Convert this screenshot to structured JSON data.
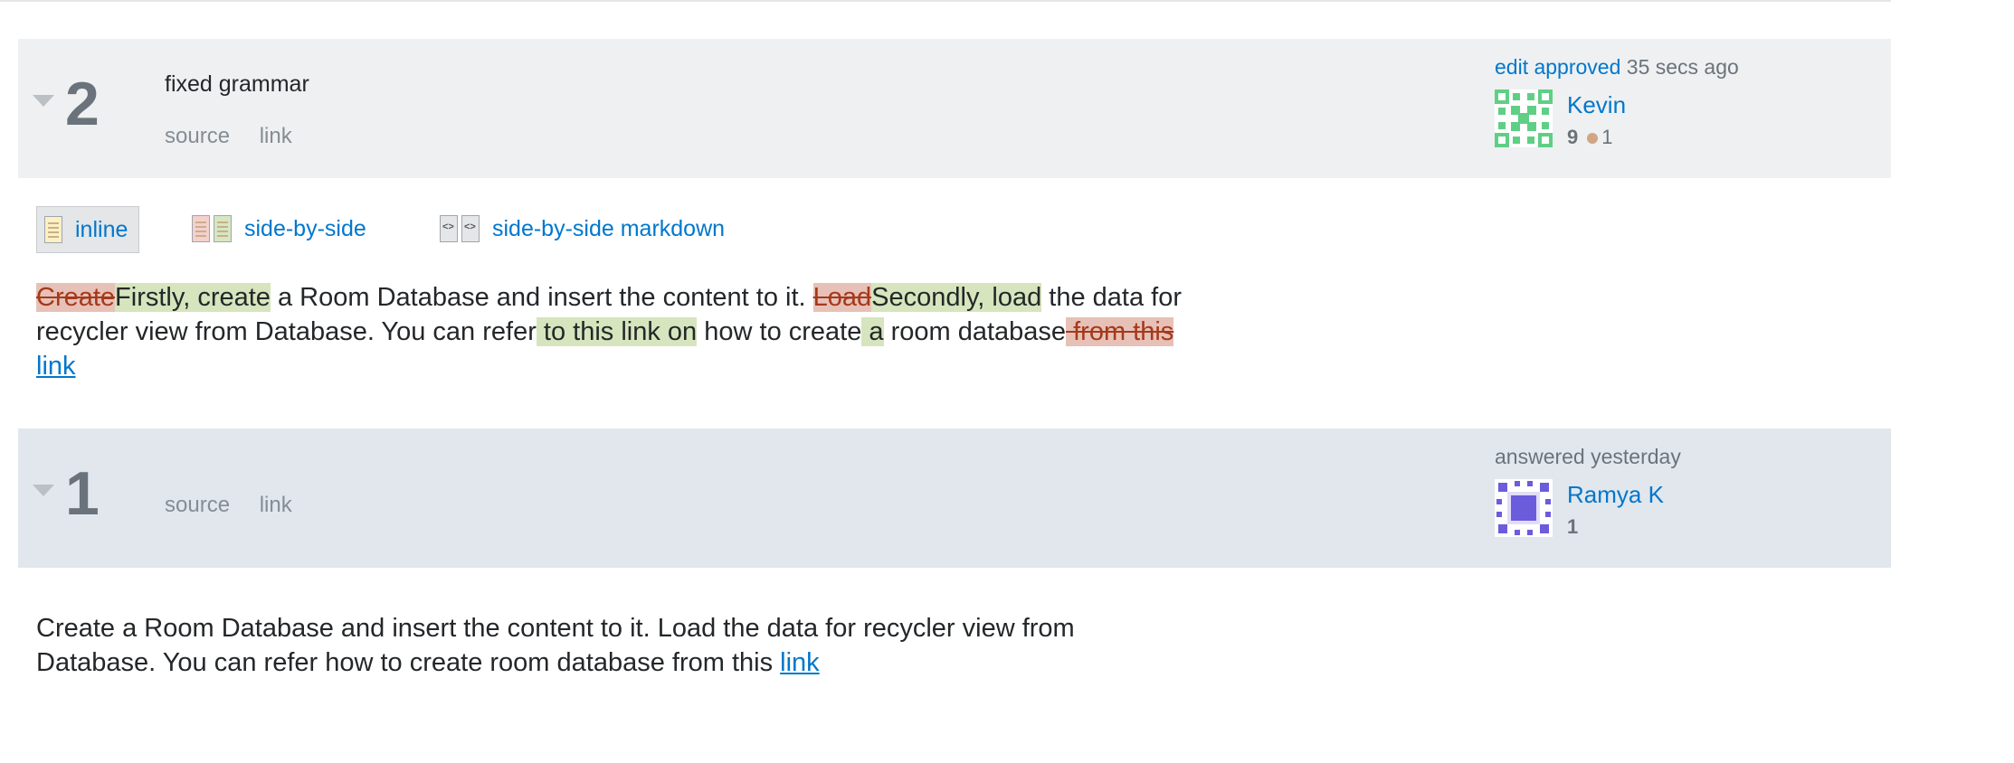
{
  "revisions": [
    {
      "number": "2",
      "comment": "fixed grammar",
      "links": {
        "source": "source",
        "link": "link"
      },
      "info": {
        "action_link": "edit approved",
        "time": "35 secs ago"
      },
      "user": {
        "name": "Kevin",
        "reputation": "9",
        "bronze_badges": "1",
        "avatar_color": "#5fcf86"
      }
    },
    {
      "number": "1",
      "links": {
        "source": "source",
        "link": "link"
      },
      "info": {
        "action": "answered yesterday"
      },
      "user": {
        "name": "Ramya K",
        "reputation": "1",
        "avatar_color": "#6b5cdc"
      }
    }
  ],
  "view_tabs": {
    "inline": "inline",
    "side_by_side": "side-by-side",
    "side_by_side_markdown": "side-by-side markdown",
    "active": "inline"
  },
  "diff": {
    "del_1": "Create",
    "ins_1": "Firstly, create",
    "text_1": " a Room Database and insert the content to it. ",
    "del_2": "Load",
    "ins_2": "Secondly, load",
    "text_2": " the data for recycler view from Database. You can refer",
    "ins_3": " to this link on",
    "text_3": " how to create",
    "ins_4": " a",
    "text_4": " room database",
    "del_3": " from this",
    "link": "link"
  },
  "original_body": {
    "text": "Create a Room Database and insert the content to it. Load the data for recycler view from Database. You can refer how to create room database from this ",
    "link": "link"
  },
  "colors": {
    "link": "#0077cc",
    "inserted": "#d6e5bd",
    "deleted": "#e7c1b7",
    "header_edit": "#eff0f1",
    "header_original": "#e1e7ed"
  }
}
